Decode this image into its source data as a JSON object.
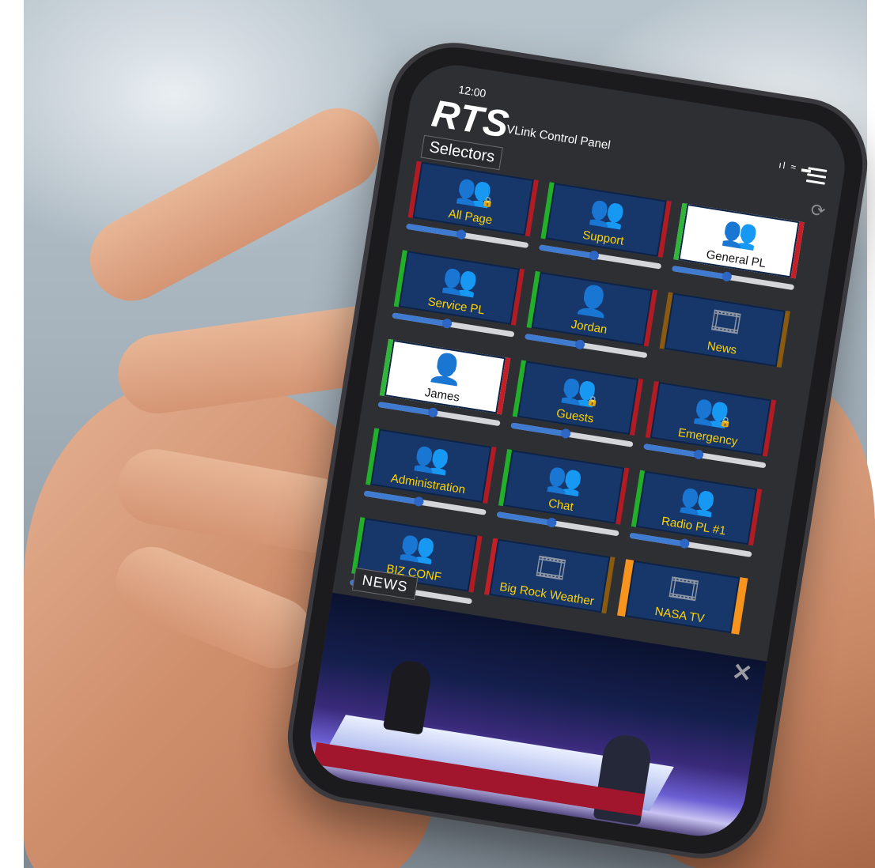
{
  "status": {
    "time": "12:00",
    "signal_icons": "ıl ≈ ▬"
  },
  "header": {
    "logo": "RTS",
    "title": "VLink Control Panel"
  },
  "selectors": {
    "label": "Selectors",
    "tiles": [
      {
        "label": "All Page",
        "icon": "group-icon",
        "locked": true,
        "volume": 0.45
      },
      {
        "label": "Support",
        "icon": "group-icon",
        "locked": false,
        "volume": 0.45
      },
      {
        "label": "General PL",
        "icon": "group-icon",
        "locked": false,
        "volume": 0.45
      },
      {
        "label": "Service PL",
        "icon": "group-icon",
        "locked": false,
        "volume": 0.45
      },
      {
        "label": "Jordan",
        "icon": "person-icon",
        "locked": false,
        "volume": 0.45
      },
      {
        "label": "News",
        "icon": "video-icon",
        "locked": false
      },
      {
        "label": "James",
        "icon": "person-icon",
        "locked": false,
        "volume": 0.45
      },
      {
        "label": "Guests",
        "icon": "group-icon",
        "locked": true,
        "volume": 0.45
      },
      {
        "label": "Emergency",
        "icon": "group-icon",
        "locked": true,
        "volume": 0.45
      },
      {
        "label": "Administration",
        "icon": "group-icon",
        "locked": false,
        "volume": 0.45
      },
      {
        "label": "Chat",
        "icon": "group-icon",
        "locked": false,
        "volume": 0.45
      },
      {
        "label": "Radio PL #1",
        "icon": "group-icon",
        "locked": false,
        "volume": 0.45
      },
      {
        "label": "BIZ CONF",
        "icon": "group-icon",
        "locked": false,
        "volume": 0.45
      },
      {
        "label": "Big Rock Weather",
        "icon": "video-icon",
        "locked": false
      },
      {
        "label": "NASA TV",
        "icon": "video-icon",
        "locked": false
      }
    ]
  },
  "video_panel": {
    "label": "NEWS"
  },
  "colors": {
    "tile_bg": "#17376b",
    "label_yellow": "#ffd200",
    "active_green": "#22b02a",
    "status_red": "#b21b22",
    "video_orange": "#f7941d",
    "slider_blue": "#3e7bd1"
  }
}
